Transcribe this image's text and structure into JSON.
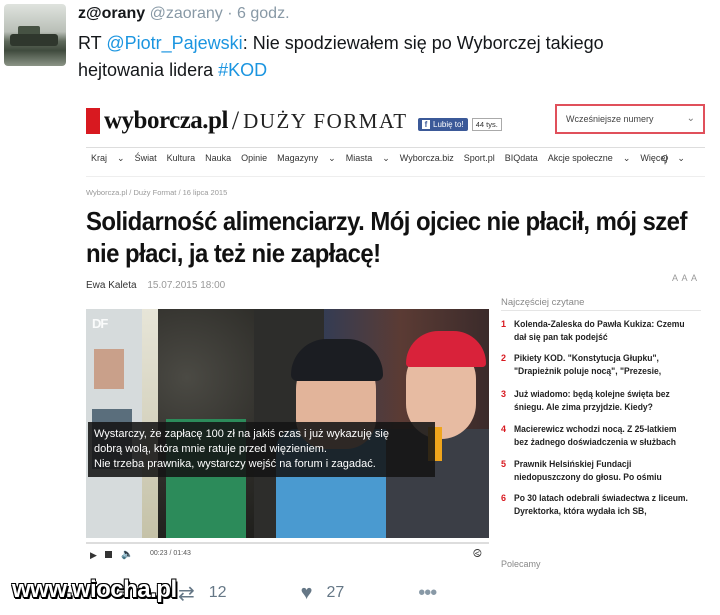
{
  "tweet": {
    "display_name": "z@orany",
    "handle": "@zaorany",
    "time": "6 godz.",
    "rt_prefix": "RT",
    "mention": "@Piotr_Pajewski",
    "text_main": ": Nie spodziewałem się po Wyborczej takiego",
    "text_line2": "hejtowania lidera",
    "hashtag": "#KOD",
    "retweet_count": "12",
    "like_count": "27"
  },
  "article": {
    "logo_brand": "wyborcza.pl",
    "logo_slash": "/",
    "logo_section": "DUŻY FORMAT",
    "fb_like": "Lubię to!",
    "fb_count": "44 tys.",
    "issues_select": "Wcześniejsze numery",
    "nav": [
      "Kraj",
      "Świat",
      "Kultura",
      "Nauka",
      "Opinie",
      "Magazyny",
      "Miasta",
      "Wyborcza.biz",
      "Sport.pl",
      "BIQdata",
      "Akcje społeczne",
      "Więcej"
    ],
    "breadcrumb": "Wyborcza.pl / Duży Format / 16 lipca 2015",
    "headline_1": "Solidarność alimenciarzy. Mój ojciec nie płacił, mój szef",
    "headline_2": "nie płaci, ja też nie zapłacę!",
    "author": "Ewa Kaleta",
    "date": "15.07.2015 18:00",
    "font_size_ctrl": "A A A",
    "video_logo": "DF",
    "quote_1": "Wystarczy, że zapłacę 100 zł na jakiś czas i już wykazuję się",
    "quote_2": "dobrą wolą, która mnie ratuje przed więzieniem.",
    "quote_3": "Nie trzeba prawnika, wystarczy wejść na forum i zagadać.",
    "video_time": "00:23 / 01:43",
    "sidebar_title": "Najczęściej czytane",
    "sidebar_items": [
      {
        "num": "1",
        "text": "Kolenda-Zaleska do Pawła Kukiza: Czemu dał się pan tak podejść"
      },
      {
        "num": "2",
        "text": "Pikiety KOD. \"Konstytucja Głupku\", \"Drapieżnik poluje nocą\", \"Prezesie,"
      },
      {
        "num": "3",
        "text": "Już wiadomo: będą kolejne święta bez śniegu. Ale zima przyjdzie. Kiedy?"
      },
      {
        "num": "4",
        "text": "Macierewicz wchodzi nocą. Z 25-latkiem bez żadnego doświadczenia w służbach"
      },
      {
        "num": "5",
        "text": "Prawnik Helsińskiej Fundacji niedopuszczony do głosu. Po ośmiu"
      },
      {
        "num": "6",
        "text": "Po 30 latach odebrali świadectwa z liceum. Dyrektorka, która wydała ich SB,"
      }
    ],
    "polecamy": "Polecamy"
  },
  "watermark": "www.wiocha.pl"
}
